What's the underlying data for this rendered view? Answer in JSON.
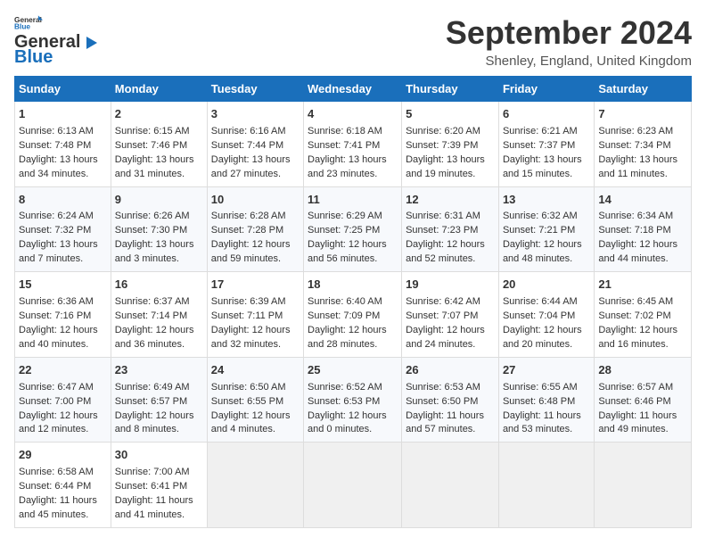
{
  "header": {
    "logo_line1": "General",
    "logo_line2": "Blue",
    "month_title": "September 2024",
    "location": "Shenley, England, United Kingdom"
  },
  "days_of_week": [
    "Sunday",
    "Monday",
    "Tuesday",
    "Wednesday",
    "Thursday",
    "Friday",
    "Saturday"
  ],
  "weeks": [
    [
      {
        "day": "1",
        "lines": [
          "Sunrise: 6:13 AM",
          "Sunset: 7:48 PM",
          "Daylight: 13 hours",
          "and 34 minutes."
        ]
      },
      {
        "day": "2",
        "lines": [
          "Sunrise: 6:15 AM",
          "Sunset: 7:46 PM",
          "Daylight: 13 hours",
          "and 31 minutes."
        ]
      },
      {
        "day": "3",
        "lines": [
          "Sunrise: 6:16 AM",
          "Sunset: 7:44 PM",
          "Daylight: 13 hours",
          "and 27 minutes."
        ]
      },
      {
        "day": "4",
        "lines": [
          "Sunrise: 6:18 AM",
          "Sunset: 7:41 PM",
          "Daylight: 13 hours",
          "and 23 minutes."
        ]
      },
      {
        "day": "5",
        "lines": [
          "Sunrise: 6:20 AM",
          "Sunset: 7:39 PM",
          "Daylight: 13 hours",
          "and 19 minutes."
        ]
      },
      {
        "day": "6",
        "lines": [
          "Sunrise: 6:21 AM",
          "Sunset: 7:37 PM",
          "Daylight: 13 hours",
          "and 15 minutes."
        ]
      },
      {
        "day": "7",
        "lines": [
          "Sunrise: 6:23 AM",
          "Sunset: 7:34 PM",
          "Daylight: 13 hours",
          "and 11 minutes."
        ]
      }
    ],
    [
      {
        "day": "8",
        "lines": [
          "Sunrise: 6:24 AM",
          "Sunset: 7:32 PM",
          "Daylight: 13 hours",
          "and 7 minutes."
        ]
      },
      {
        "day": "9",
        "lines": [
          "Sunrise: 6:26 AM",
          "Sunset: 7:30 PM",
          "Daylight: 13 hours",
          "and 3 minutes."
        ]
      },
      {
        "day": "10",
        "lines": [
          "Sunrise: 6:28 AM",
          "Sunset: 7:28 PM",
          "Daylight: 12 hours",
          "and 59 minutes."
        ]
      },
      {
        "day": "11",
        "lines": [
          "Sunrise: 6:29 AM",
          "Sunset: 7:25 PM",
          "Daylight: 12 hours",
          "and 56 minutes."
        ]
      },
      {
        "day": "12",
        "lines": [
          "Sunrise: 6:31 AM",
          "Sunset: 7:23 PM",
          "Daylight: 12 hours",
          "and 52 minutes."
        ]
      },
      {
        "day": "13",
        "lines": [
          "Sunrise: 6:32 AM",
          "Sunset: 7:21 PM",
          "Daylight: 12 hours",
          "and 48 minutes."
        ]
      },
      {
        "day": "14",
        "lines": [
          "Sunrise: 6:34 AM",
          "Sunset: 7:18 PM",
          "Daylight: 12 hours",
          "and 44 minutes."
        ]
      }
    ],
    [
      {
        "day": "15",
        "lines": [
          "Sunrise: 6:36 AM",
          "Sunset: 7:16 PM",
          "Daylight: 12 hours",
          "and 40 minutes."
        ]
      },
      {
        "day": "16",
        "lines": [
          "Sunrise: 6:37 AM",
          "Sunset: 7:14 PM",
          "Daylight: 12 hours",
          "and 36 minutes."
        ]
      },
      {
        "day": "17",
        "lines": [
          "Sunrise: 6:39 AM",
          "Sunset: 7:11 PM",
          "Daylight: 12 hours",
          "and 32 minutes."
        ]
      },
      {
        "day": "18",
        "lines": [
          "Sunrise: 6:40 AM",
          "Sunset: 7:09 PM",
          "Daylight: 12 hours",
          "and 28 minutes."
        ]
      },
      {
        "day": "19",
        "lines": [
          "Sunrise: 6:42 AM",
          "Sunset: 7:07 PM",
          "Daylight: 12 hours",
          "and 24 minutes."
        ]
      },
      {
        "day": "20",
        "lines": [
          "Sunrise: 6:44 AM",
          "Sunset: 7:04 PM",
          "Daylight: 12 hours",
          "and 20 minutes."
        ]
      },
      {
        "day": "21",
        "lines": [
          "Sunrise: 6:45 AM",
          "Sunset: 7:02 PM",
          "Daylight: 12 hours",
          "and 16 minutes."
        ]
      }
    ],
    [
      {
        "day": "22",
        "lines": [
          "Sunrise: 6:47 AM",
          "Sunset: 7:00 PM",
          "Daylight: 12 hours",
          "and 12 minutes."
        ]
      },
      {
        "day": "23",
        "lines": [
          "Sunrise: 6:49 AM",
          "Sunset: 6:57 PM",
          "Daylight: 12 hours",
          "and 8 minutes."
        ]
      },
      {
        "day": "24",
        "lines": [
          "Sunrise: 6:50 AM",
          "Sunset: 6:55 PM",
          "Daylight: 12 hours",
          "and 4 minutes."
        ]
      },
      {
        "day": "25",
        "lines": [
          "Sunrise: 6:52 AM",
          "Sunset: 6:53 PM",
          "Daylight: 12 hours",
          "and 0 minutes."
        ]
      },
      {
        "day": "26",
        "lines": [
          "Sunrise: 6:53 AM",
          "Sunset: 6:50 PM",
          "Daylight: 11 hours",
          "and 57 minutes."
        ]
      },
      {
        "day": "27",
        "lines": [
          "Sunrise: 6:55 AM",
          "Sunset: 6:48 PM",
          "Daylight: 11 hours",
          "and 53 minutes."
        ]
      },
      {
        "day": "28",
        "lines": [
          "Sunrise: 6:57 AM",
          "Sunset: 6:46 PM",
          "Daylight: 11 hours",
          "and 49 minutes."
        ]
      }
    ],
    [
      {
        "day": "29",
        "lines": [
          "Sunrise: 6:58 AM",
          "Sunset: 6:44 PM",
          "Daylight: 11 hours",
          "and 45 minutes."
        ]
      },
      {
        "day": "30",
        "lines": [
          "Sunrise: 7:00 AM",
          "Sunset: 6:41 PM",
          "Daylight: 11 hours",
          "and 41 minutes."
        ]
      },
      {
        "day": "",
        "lines": []
      },
      {
        "day": "",
        "lines": []
      },
      {
        "day": "",
        "lines": []
      },
      {
        "day": "",
        "lines": []
      },
      {
        "day": "",
        "lines": []
      }
    ]
  ]
}
